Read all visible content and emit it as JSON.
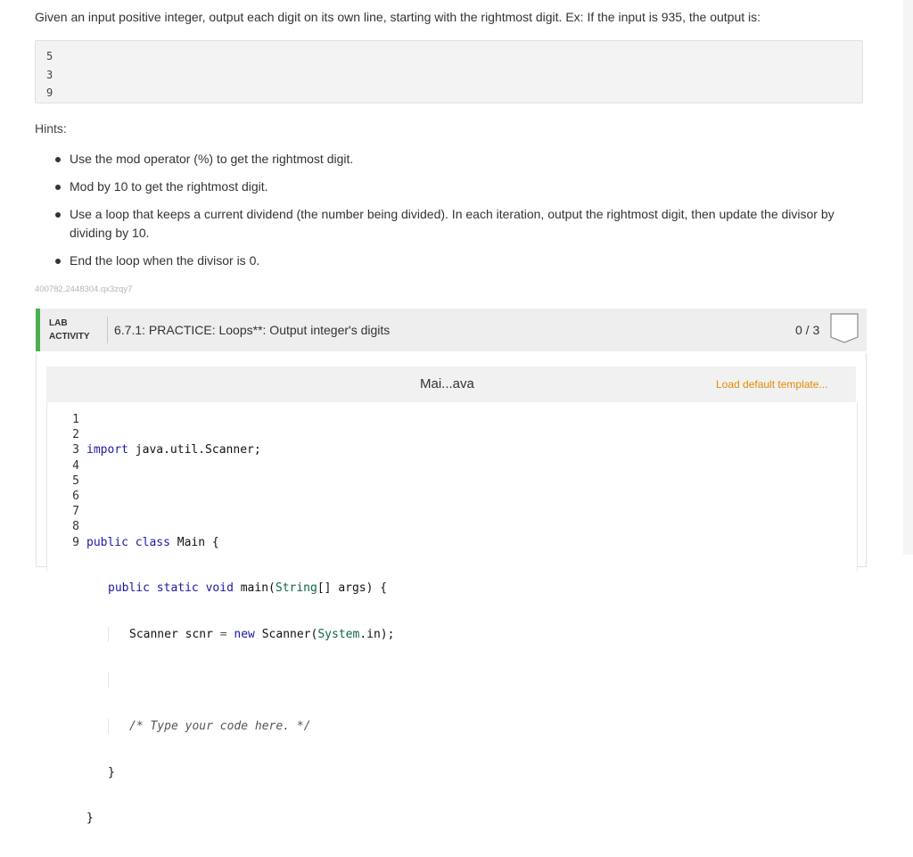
{
  "prompt": "Given an input positive integer, output each digit on its own line, starting with the rightmost digit. Ex: If the input is 935, the output is:",
  "sample_output": [
    "5",
    "3",
    "9"
  ],
  "hints_label": "Hints:",
  "hints": [
    "Use the mod operator (%) to get the rightmost digit.",
    "Mod by 10 to get the rightmost digit.",
    "Use a loop that keeps a current dividend (the number being divided). In each iteration, output the rightmost digit, then update the divisor by dividing by 10.",
    "End the loop when the divisor is 0."
  ],
  "problem_id": "400782.2448304.qx3zqy7",
  "lab": {
    "label_line1": "LAB",
    "label_line2": "ACTIVITY",
    "title": "6.7.1: PRACTICE: Loops**: Output integer's digits",
    "score": "0 / 3",
    "accent_color": "#4caf50"
  },
  "editor": {
    "file_name": "Mai...ava",
    "load_template": "Load default template...",
    "line_numbers": [
      "1",
      "2",
      "3",
      "4",
      "5",
      "6",
      "7",
      "8",
      "9"
    ],
    "code": {
      "l1_kw": "import",
      "l1_rest": " java.util.Scanner;",
      "l3_kw1": "public",
      "l3_kw2": "class",
      "l3_rest": " Main {",
      "l4_kw1": "public",
      "l4_kw2": "static",
      "l4_kw3": "void",
      "l4_mid": " main(",
      "l4_type": "String",
      "l4_rest": "[] args) {",
      "l5_a": "Scanner scnr ",
      "l5_eq": "=",
      "l5_new": "new",
      "l5_b": " Scanner(",
      "l5_sys": "System",
      "l5_c": ".in);",
      "l7_comment": "/* Type your code here. */",
      "l8": "}",
      "l9": "}"
    }
  }
}
